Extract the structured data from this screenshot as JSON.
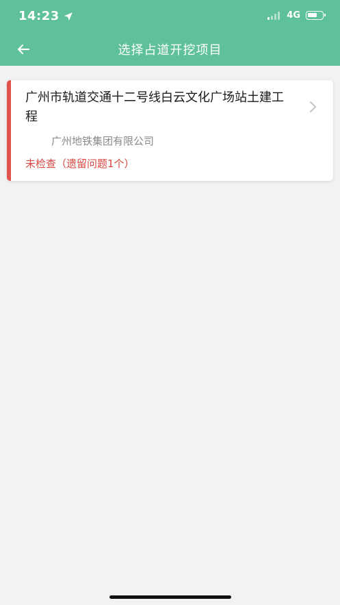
{
  "status_bar": {
    "time": "14:23",
    "network": "4G",
    "battery_fraction": 0.7,
    "location_icon": "location-arrow-icon"
  },
  "nav": {
    "title": "选择占道开挖项目",
    "back_icon": "arrow-left-icon"
  },
  "colors": {
    "header": "#5ec19a",
    "accent": "#e0514a",
    "status_text": "#d8463f",
    "background": "#f2f2f4"
  },
  "projects": [
    {
      "name": "广州市轨道交通十二号线白云文化广场站土建工程",
      "company": "广州地铁集团有限公司",
      "status": "未检查（遗留问题1个）"
    }
  ]
}
